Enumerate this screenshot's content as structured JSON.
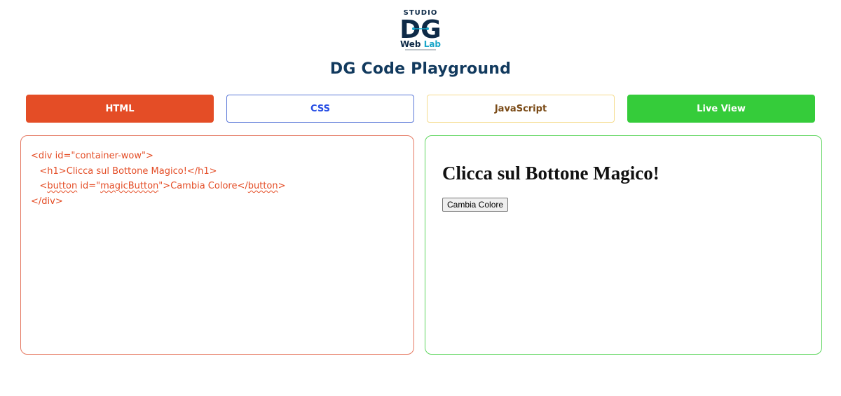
{
  "header": {
    "logo": {
      "top_text": "STUDIO",
      "main_text": "DG",
      "bottom_text": "Web Lab",
      "primary_color": "#0e2a47",
      "accent_color": "#1aa6c9"
    },
    "title": "DG Code Playground"
  },
  "tabs": [
    {
      "label": "HTML",
      "active": true,
      "color": "#e44d26"
    },
    {
      "label": "CSS",
      "active": false,
      "color": "#264de4"
    },
    {
      "label": "JavaScript",
      "active": false,
      "color": "#7a4a16"
    },
    {
      "label": "Live View",
      "active": false,
      "color": "#35cc3a"
    }
  ],
  "editor": {
    "line1": "<div id=\"container-wow\">",
    "line2": "<h1>Clicca sul Bottone Magico!</h1>",
    "line3_open_lt": "<",
    "line3_tag": "button",
    "line3_attr": " id=\"",
    "line3_id": "magicButton",
    "line3_text": "\">Cambia Colore</",
    "line3_close_tag": "button",
    "line3_end": ">",
    "line4": "</div>"
  },
  "preview": {
    "heading": "Clicca sul Bottone Magico!",
    "button_label": "Cambia Colore"
  }
}
